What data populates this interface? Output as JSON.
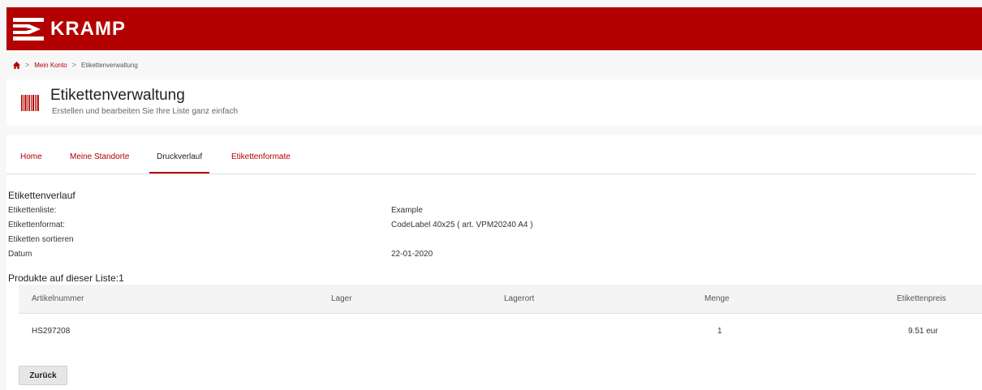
{
  "brand": {
    "name": "KRAMP",
    "color": "#b30000"
  },
  "breadcrumb": {
    "home_icon": "home-icon",
    "separator": ">",
    "items": [
      "Mein Konto",
      "Etikettenverwaltung"
    ]
  },
  "header": {
    "icon": "barcode-icon",
    "title": "Etikettenverwaltung",
    "subtitle": "Erstellen und bearbeiten Sie Ihre Liste ganz einfach"
  },
  "tabs": [
    {
      "label": "Home",
      "active": false
    },
    {
      "label": "Meine Standorte",
      "active": false
    },
    {
      "label": "Druckverlauf",
      "active": true
    },
    {
      "label": "Etikettenformate",
      "active": false
    }
  ],
  "history": {
    "title": "Etikettenverlauf",
    "rows": [
      {
        "label": "Etikettenliste:",
        "value": "Example"
      },
      {
        "label": "Etikettenformat:",
        "value": "CodeLabel 40x25 ( art. VPM20240 A4 )"
      },
      {
        "label": "Etiketten sortieren",
        "value": ""
      },
      {
        "label": "Datum",
        "value": "22-01-2020"
      }
    ]
  },
  "products": {
    "title": "Produkte auf dieser Liste:1",
    "columns": [
      "Artikelnummer",
      "Lager",
      "Lagerort",
      "Menge",
      "Etikettenpreis"
    ],
    "rows": [
      [
        "HS297208",
        "",
        "",
        "1",
        "9.51 eur"
      ]
    ]
  },
  "back_button": {
    "label": "Zurück"
  }
}
